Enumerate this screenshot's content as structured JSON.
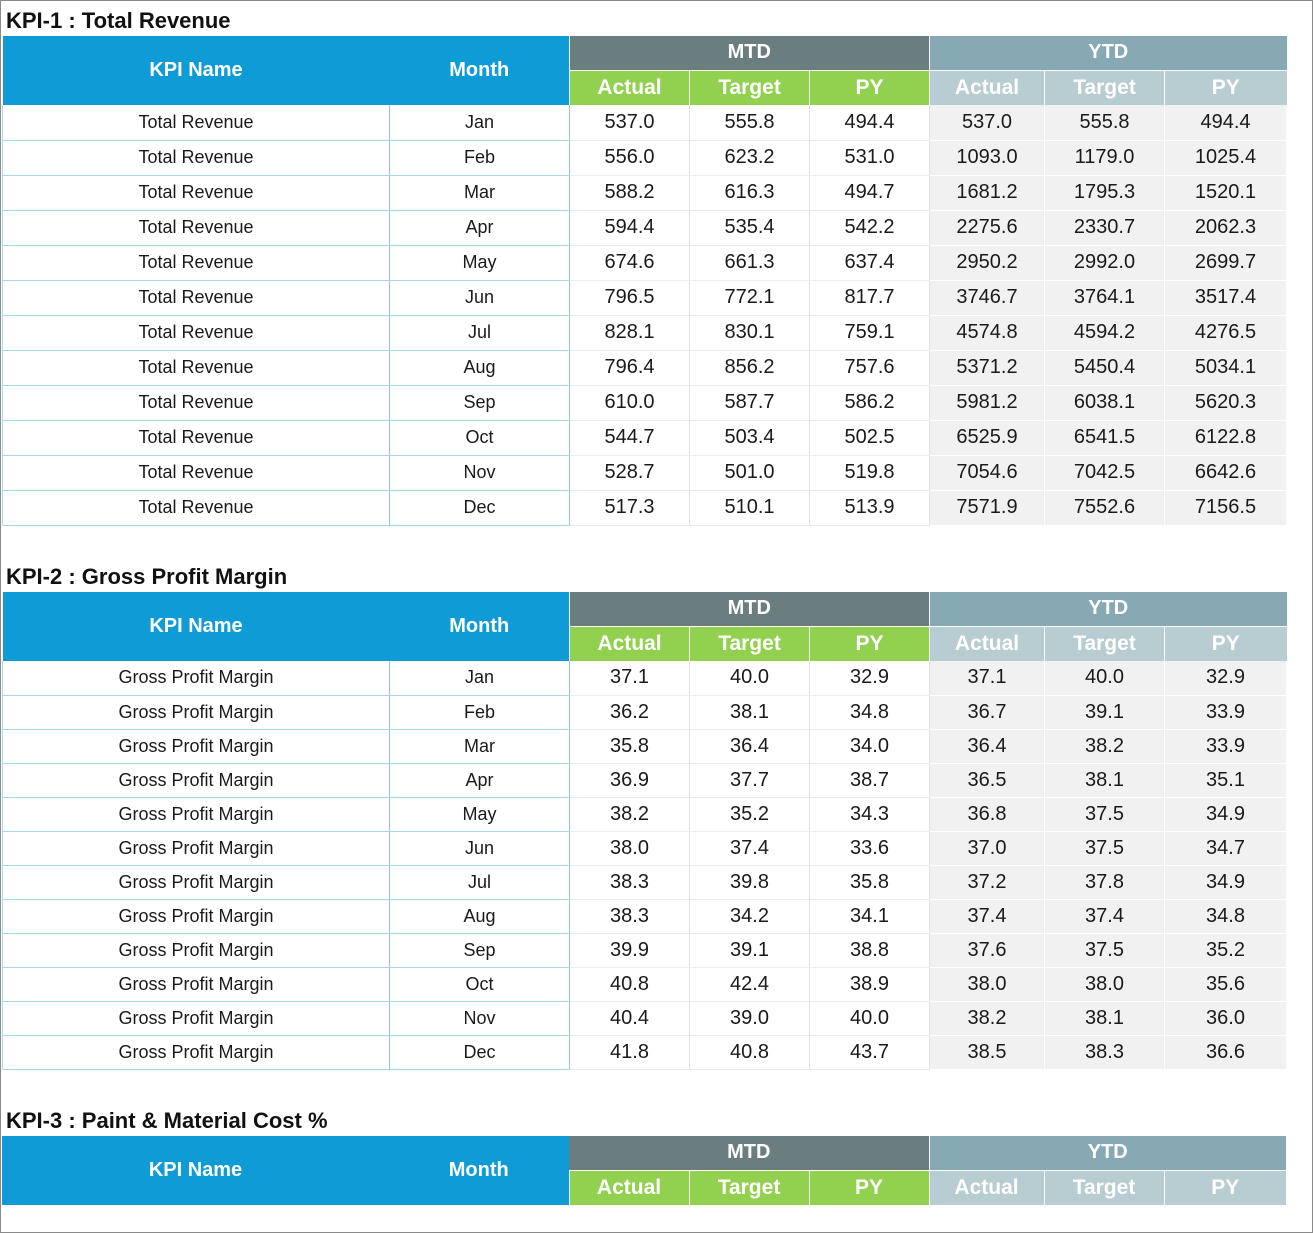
{
  "headers": {
    "kpi_name": "KPI Name",
    "month": "Month",
    "mtd": "MTD",
    "ytd": "YTD",
    "actual": "Actual",
    "target": "Target",
    "py": "PY"
  },
  "kpi1": {
    "title": "KPI-1 : Total Revenue",
    "rows": [
      {
        "name": "Total Revenue",
        "month": "Jan",
        "mtd_actual": "537.0",
        "mtd_target": "555.8",
        "mtd_py": "494.4",
        "ytd_actual": "537.0",
        "ytd_target": "555.8",
        "ytd_py": "494.4"
      },
      {
        "name": "Total Revenue",
        "month": "Feb",
        "mtd_actual": "556.0",
        "mtd_target": "623.2",
        "mtd_py": "531.0",
        "ytd_actual": "1093.0",
        "ytd_target": "1179.0",
        "ytd_py": "1025.4"
      },
      {
        "name": "Total Revenue",
        "month": "Mar",
        "mtd_actual": "588.2",
        "mtd_target": "616.3",
        "mtd_py": "494.7",
        "ytd_actual": "1681.2",
        "ytd_target": "1795.3",
        "ytd_py": "1520.1"
      },
      {
        "name": "Total Revenue",
        "month": "Apr",
        "mtd_actual": "594.4",
        "mtd_target": "535.4",
        "mtd_py": "542.2",
        "ytd_actual": "2275.6",
        "ytd_target": "2330.7",
        "ytd_py": "2062.3"
      },
      {
        "name": "Total Revenue",
        "month": "May",
        "mtd_actual": "674.6",
        "mtd_target": "661.3",
        "mtd_py": "637.4",
        "ytd_actual": "2950.2",
        "ytd_target": "2992.0",
        "ytd_py": "2699.7"
      },
      {
        "name": "Total Revenue",
        "month": "Jun",
        "mtd_actual": "796.5",
        "mtd_target": "772.1",
        "mtd_py": "817.7",
        "ytd_actual": "3746.7",
        "ytd_target": "3764.1",
        "ytd_py": "3517.4"
      },
      {
        "name": "Total Revenue",
        "month": "Jul",
        "mtd_actual": "828.1",
        "mtd_target": "830.1",
        "mtd_py": "759.1",
        "ytd_actual": "4574.8",
        "ytd_target": "4594.2",
        "ytd_py": "4276.5"
      },
      {
        "name": "Total Revenue",
        "month": "Aug",
        "mtd_actual": "796.4",
        "mtd_target": "856.2",
        "mtd_py": "757.6",
        "ytd_actual": "5371.2",
        "ytd_target": "5450.4",
        "ytd_py": "5034.1"
      },
      {
        "name": "Total Revenue",
        "month": "Sep",
        "mtd_actual": "610.0",
        "mtd_target": "587.7",
        "mtd_py": "586.2",
        "ytd_actual": "5981.2",
        "ytd_target": "6038.1",
        "ytd_py": "5620.3"
      },
      {
        "name": "Total Revenue",
        "month": "Oct",
        "mtd_actual": "544.7",
        "mtd_target": "503.4",
        "mtd_py": "502.5",
        "ytd_actual": "6525.9",
        "ytd_target": "6541.5",
        "ytd_py": "6122.8"
      },
      {
        "name": "Total Revenue",
        "month": "Nov",
        "mtd_actual": "528.7",
        "mtd_target": "501.0",
        "mtd_py": "519.8",
        "ytd_actual": "7054.6",
        "ytd_target": "7042.5",
        "ytd_py": "6642.6"
      },
      {
        "name": "Total Revenue",
        "month": "Dec",
        "mtd_actual": "517.3",
        "mtd_target": "510.1",
        "mtd_py": "513.9",
        "ytd_actual": "7571.9",
        "ytd_target": "7552.6",
        "ytd_py": "7156.5"
      }
    ]
  },
  "kpi2": {
    "title": "KPI-2 : Gross Profit Margin",
    "rows": [
      {
        "name": "Gross Profit Margin",
        "month": "Jan",
        "mtd_actual": "37.1",
        "mtd_target": "40.0",
        "mtd_py": "32.9",
        "ytd_actual": "37.1",
        "ytd_target": "40.0",
        "ytd_py": "32.9"
      },
      {
        "name": "Gross Profit Margin",
        "month": "Feb",
        "mtd_actual": "36.2",
        "mtd_target": "38.1",
        "mtd_py": "34.8",
        "ytd_actual": "36.7",
        "ytd_target": "39.1",
        "ytd_py": "33.9"
      },
      {
        "name": "Gross Profit Margin",
        "month": "Mar",
        "mtd_actual": "35.8",
        "mtd_target": "36.4",
        "mtd_py": "34.0",
        "ytd_actual": "36.4",
        "ytd_target": "38.2",
        "ytd_py": "33.9"
      },
      {
        "name": "Gross Profit Margin",
        "month": "Apr",
        "mtd_actual": "36.9",
        "mtd_target": "37.7",
        "mtd_py": "38.7",
        "ytd_actual": "36.5",
        "ytd_target": "38.1",
        "ytd_py": "35.1"
      },
      {
        "name": "Gross Profit Margin",
        "month": "May",
        "mtd_actual": "38.2",
        "mtd_target": "35.2",
        "mtd_py": "34.3",
        "ytd_actual": "36.8",
        "ytd_target": "37.5",
        "ytd_py": "34.9"
      },
      {
        "name": "Gross Profit Margin",
        "month": "Jun",
        "mtd_actual": "38.0",
        "mtd_target": "37.4",
        "mtd_py": "33.6",
        "ytd_actual": "37.0",
        "ytd_target": "37.5",
        "ytd_py": "34.7"
      },
      {
        "name": "Gross Profit Margin",
        "month": "Jul",
        "mtd_actual": "38.3",
        "mtd_target": "39.8",
        "mtd_py": "35.8",
        "ytd_actual": "37.2",
        "ytd_target": "37.8",
        "ytd_py": "34.9"
      },
      {
        "name": "Gross Profit Margin",
        "month": "Aug",
        "mtd_actual": "38.3",
        "mtd_target": "34.2",
        "mtd_py": "34.1",
        "ytd_actual": "37.4",
        "ytd_target": "37.4",
        "ytd_py": "34.8"
      },
      {
        "name": "Gross Profit Margin",
        "month": "Sep",
        "mtd_actual": "39.9",
        "mtd_target": "39.1",
        "mtd_py": "38.8",
        "ytd_actual": "37.6",
        "ytd_target": "37.5",
        "ytd_py": "35.2"
      },
      {
        "name": "Gross Profit Margin",
        "month": "Oct",
        "mtd_actual": "40.8",
        "mtd_target": "42.4",
        "mtd_py": "38.9",
        "ytd_actual": "38.0",
        "ytd_target": "38.0",
        "ytd_py": "35.6"
      },
      {
        "name": "Gross Profit Margin",
        "month": "Nov",
        "mtd_actual": "40.4",
        "mtd_target": "39.0",
        "mtd_py": "40.0",
        "ytd_actual": "38.2",
        "ytd_target": "38.1",
        "ytd_py": "36.0"
      },
      {
        "name": "Gross Profit Margin",
        "month": "Dec",
        "mtd_actual": "41.8",
        "mtd_target": "40.8",
        "mtd_py": "43.7",
        "ytd_actual": "38.5",
        "ytd_target": "38.3",
        "ytd_py": "36.6"
      }
    ]
  },
  "kpi3": {
    "title": "KPI-3 : Paint & Material Cost %",
    "rows": []
  }
}
